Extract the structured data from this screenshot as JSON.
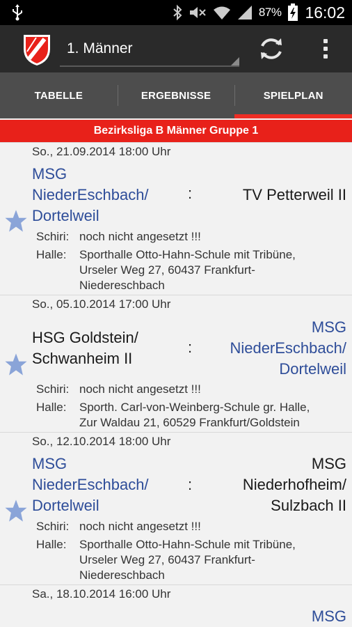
{
  "status_bar": {
    "battery_percent": "87%",
    "time": "16:02",
    "icons": [
      "usb-icon",
      "bluetooth-icon",
      "mute-icon",
      "wifi-icon",
      "signal-icon",
      "battery-icon"
    ]
  },
  "action_bar": {
    "team_selected": "1. Männer",
    "icons": [
      "club-logo-icon",
      "refresh-icon",
      "overflow-menu-icon"
    ]
  },
  "tabs": [
    {
      "label": "TABELLE",
      "active": false
    },
    {
      "label": "ERGEBNISSE",
      "active": false
    },
    {
      "label": "SPIELPLAN",
      "active": true
    }
  ],
  "league": {
    "title": "Bezirksliga B Männer Gruppe 1"
  },
  "labels": {
    "referee": "Schiri:",
    "hall": "Halle:"
  },
  "colors": {
    "accent": "#e8211a",
    "own_team": "#2e4d99",
    "star": "#8aa4d8"
  },
  "matches": [
    {
      "date": "So., 21.09.2014  18:00 Uhr",
      "home": [
        "MSG",
        "NiederEschbach/",
        "Dortelweil"
      ],
      "separator": ":",
      "away": [
        "TV Petterweil II"
      ],
      "referee": "noch nicht angesetzt !!!",
      "hall": [
        "Sporthalle Otto-Hahn-Schule mit Tribüne,",
        "Urseler Weg 27, 60437 Frankfurt-",
        "Niedereschbach"
      ]
    },
    {
      "date": "So., 05.10.2014  17:00 Uhr",
      "home": [
        "HSG Goldstein/",
        "Schwanheim II"
      ],
      "separator": ":",
      "away": [
        "MSG",
        "NiederEschbach/",
        "Dortelweil"
      ],
      "referee": "noch nicht angesetzt !!!",
      "hall": [
        "Sporth. Carl-von-Weinberg-Schule gr. Halle,",
        "Zur Waldau 21, 60529 Frankfurt/Goldstein"
      ]
    },
    {
      "date": "So., 12.10.2014  18:00 Uhr",
      "home": [
        "MSG",
        "NiederEschbach/",
        "Dortelweil"
      ],
      "separator": ":",
      "away": [
        "MSG",
        "Niederhofheim/",
        "Sulzbach II"
      ],
      "referee": "noch nicht angesetzt !!!",
      "hall": [
        "Sporthalle Otto-Hahn-Schule mit Tribüne,",
        "Urseler Weg 27, 60437 Frankfurt-",
        "Niedereschbach"
      ]
    },
    {
      "date": "Sa., 18.10.2014  16:00 Uhr",
      "away": [
        "MSG"
      ]
    }
  ]
}
